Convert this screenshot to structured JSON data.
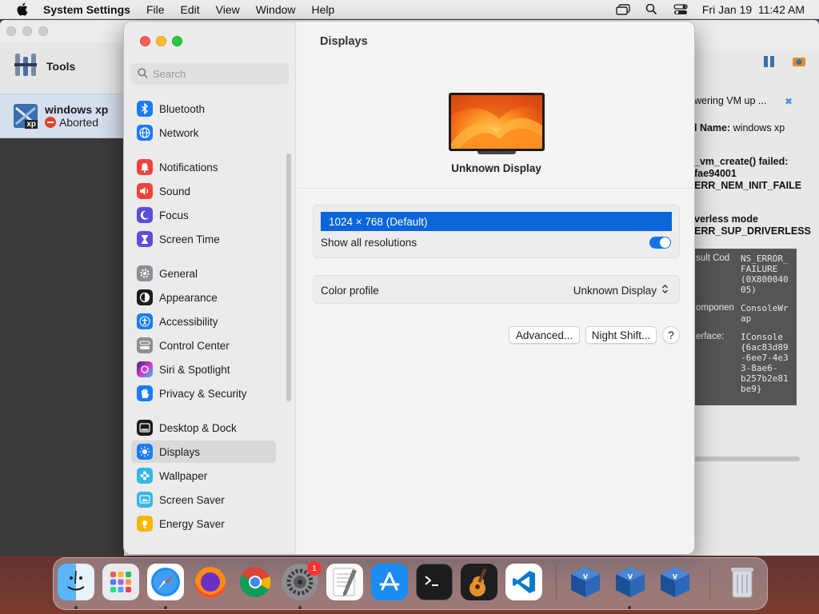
{
  "menubar": {
    "app_name": "System Settings",
    "menus": [
      "File",
      "Edit",
      "View",
      "Window",
      "Help"
    ],
    "datetime": "Fri Jan 19  11:42 AM"
  },
  "vbox": {
    "tools_label": "Tools",
    "vm_name": "windows xp",
    "vm_status": "Aborted",
    "os_badge": "xp",
    "status_title": "wering VM up ...",
    "name_label": "l Name:",
    "name_value": "windows xp",
    "error_lines": [
      "_vm_create() failed:",
      "fae94001",
      "ERR_NEM_INIT_FAILE"
    ],
    "driverless_lines": [
      "verless mode",
      "ERR_SUP_DRIVERLESS"
    ],
    "details": [
      {
        "label": "sult Cod",
        "value": "NS_ERROR_\nFAILURE\n(0X800040\n05)"
      },
      {
        "label": "omponen",
        "value": "ConsoleWr\nap"
      },
      {
        "label": "erface:",
        "value": "IConsole\n{6ac83d89\n-6ee7-4e3\n3-8ae6-\nb257b2e81\nbe9}"
      }
    ]
  },
  "settings": {
    "search_placeholder": "Search",
    "nav_items": [
      {
        "label": "Bluetooth",
        "icon": "bluetooth-icon",
        "color": "#1a7cf5"
      },
      {
        "label": "Network",
        "icon": "globe-icon",
        "color": "#1a7cf5"
      },
      {
        "label": "Notifications",
        "icon": "bell-icon",
        "color": "#f0443a"
      },
      {
        "label": "Sound",
        "icon": "speaker-icon",
        "color": "#f0443a"
      },
      {
        "label": "Focus",
        "icon": "moon-icon",
        "color": "#5a4ed6"
      },
      {
        "label": "Screen Time",
        "icon": "hourglass-icon",
        "color": "#5a4ed6"
      },
      {
        "label": "General",
        "icon": "gear-icon",
        "color": "#8e8e93"
      },
      {
        "label": "Appearance",
        "icon": "appearance-icon",
        "color": "#1c1c1e"
      },
      {
        "label": "Accessibility",
        "icon": "accessibility-icon",
        "color": "#1a7cf5"
      },
      {
        "label": "Control Center",
        "icon": "control-center-icon",
        "color": "#8e8e93"
      },
      {
        "label": "Siri & Spotlight",
        "icon": "siri-icon",
        "color": "#b03ad8"
      },
      {
        "label": "Privacy & Security",
        "icon": "hand-icon",
        "color": "#1a7cf5"
      },
      {
        "label": "Desktop & Dock",
        "icon": "dock-icon",
        "color": "#1c1c1e"
      },
      {
        "label": "Displays",
        "icon": "sun-icon",
        "color": "#1a7cf5"
      },
      {
        "label": "Wallpaper",
        "icon": "wallpaper-icon",
        "color": "#35b5e8"
      },
      {
        "label": "Screen Saver",
        "icon": "screen-saver-icon",
        "color": "#35b5e8"
      },
      {
        "label": "Energy Saver",
        "icon": "battery-icon",
        "color": "#f5b800"
      }
    ],
    "active_item": "Displays",
    "page_title": "Displays",
    "display_name": "Unknown Display",
    "resolution_selected": "1024 × 768 (Default)",
    "show_all_label": "Show all resolutions",
    "show_all_enabled": true,
    "color_profile_label": "Color profile",
    "color_profile_value": "Unknown Display",
    "advanced_button": "Advanced...",
    "night_shift_button": "Night Shift...",
    "help_button": "?"
  },
  "dock": {
    "items": [
      "finder-icon",
      "launchpad-icon",
      "safari-icon",
      "firefox-icon",
      "chrome-icon",
      "system-settings-icon",
      "textedit-icon",
      "app-store-icon",
      "terminal-icon",
      "garageband-icon",
      "vscode-icon",
      "virtualbox-icon",
      "virtualbox-icon",
      "virtualbox-icon",
      "trash-icon"
    ],
    "settings_badge": "1"
  },
  "colors": {
    "accent": "#0a66d8",
    "toggle_on": "#1673e6"
  }
}
